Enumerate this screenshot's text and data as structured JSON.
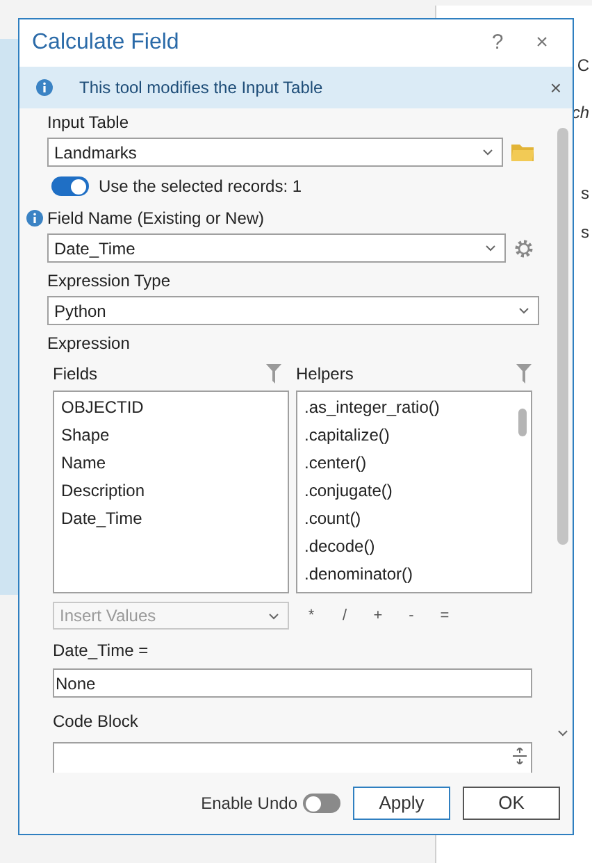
{
  "right_panel": {
    "texts": [
      "C",
      "ch",
      "s",
      "s"
    ]
  },
  "window": {
    "title": "Calculate Field",
    "buttons": [
      "?",
      "×"
    ]
  },
  "info_bar": {
    "message": "This tool modifies the Input Table",
    "close": "×"
  },
  "input_table": {
    "label": "Input Table",
    "value": "Landmarks"
  },
  "use_selected": {
    "label": "Use the selected records: 1",
    "on": true
  },
  "field_name": {
    "label": "Field Name (Existing or New)",
    "value": "Date_Time"
  },
  "expression_type": {
    "label": "Expression Type",
    "value": "Python"
  },
  "expression": {
    "label": "Expression",
    "fields_heading": "Fields",
    "helpers_heading": "Helpers",
    "fields": [
      "OBJECTID",
      "Shape",
      "Name",
      "Description",
      "Date_Time"
    ],
    "helpers": [
      ".as_integer_ratio()",
      ".capitalize()",
      ".center()",
      ".conjugate()",
      ".count()",
      ".decode()",
      ".denominator()"
    ],
    "insert_values": {
      "placeholder": "Insert Values",
      "disabled": true
    },
    "operators": [
      "*",
      "/",
      "+",
      "-",
      "="
    ],
    "target_label": "Date_Time =",
    "value": "None"
  },
  "code_block": {
    "label": "Code Block"
  },
  "footer": {
    "enable_undo": {
      "label": "Enable Undo",
      "on": false
    },
    "buttons": [
      {
        "label": "Apply",
        "kind": "default"
      },
      {
        "label": "OK",
        "kind": "normal"
      }
    ]
  }
}
